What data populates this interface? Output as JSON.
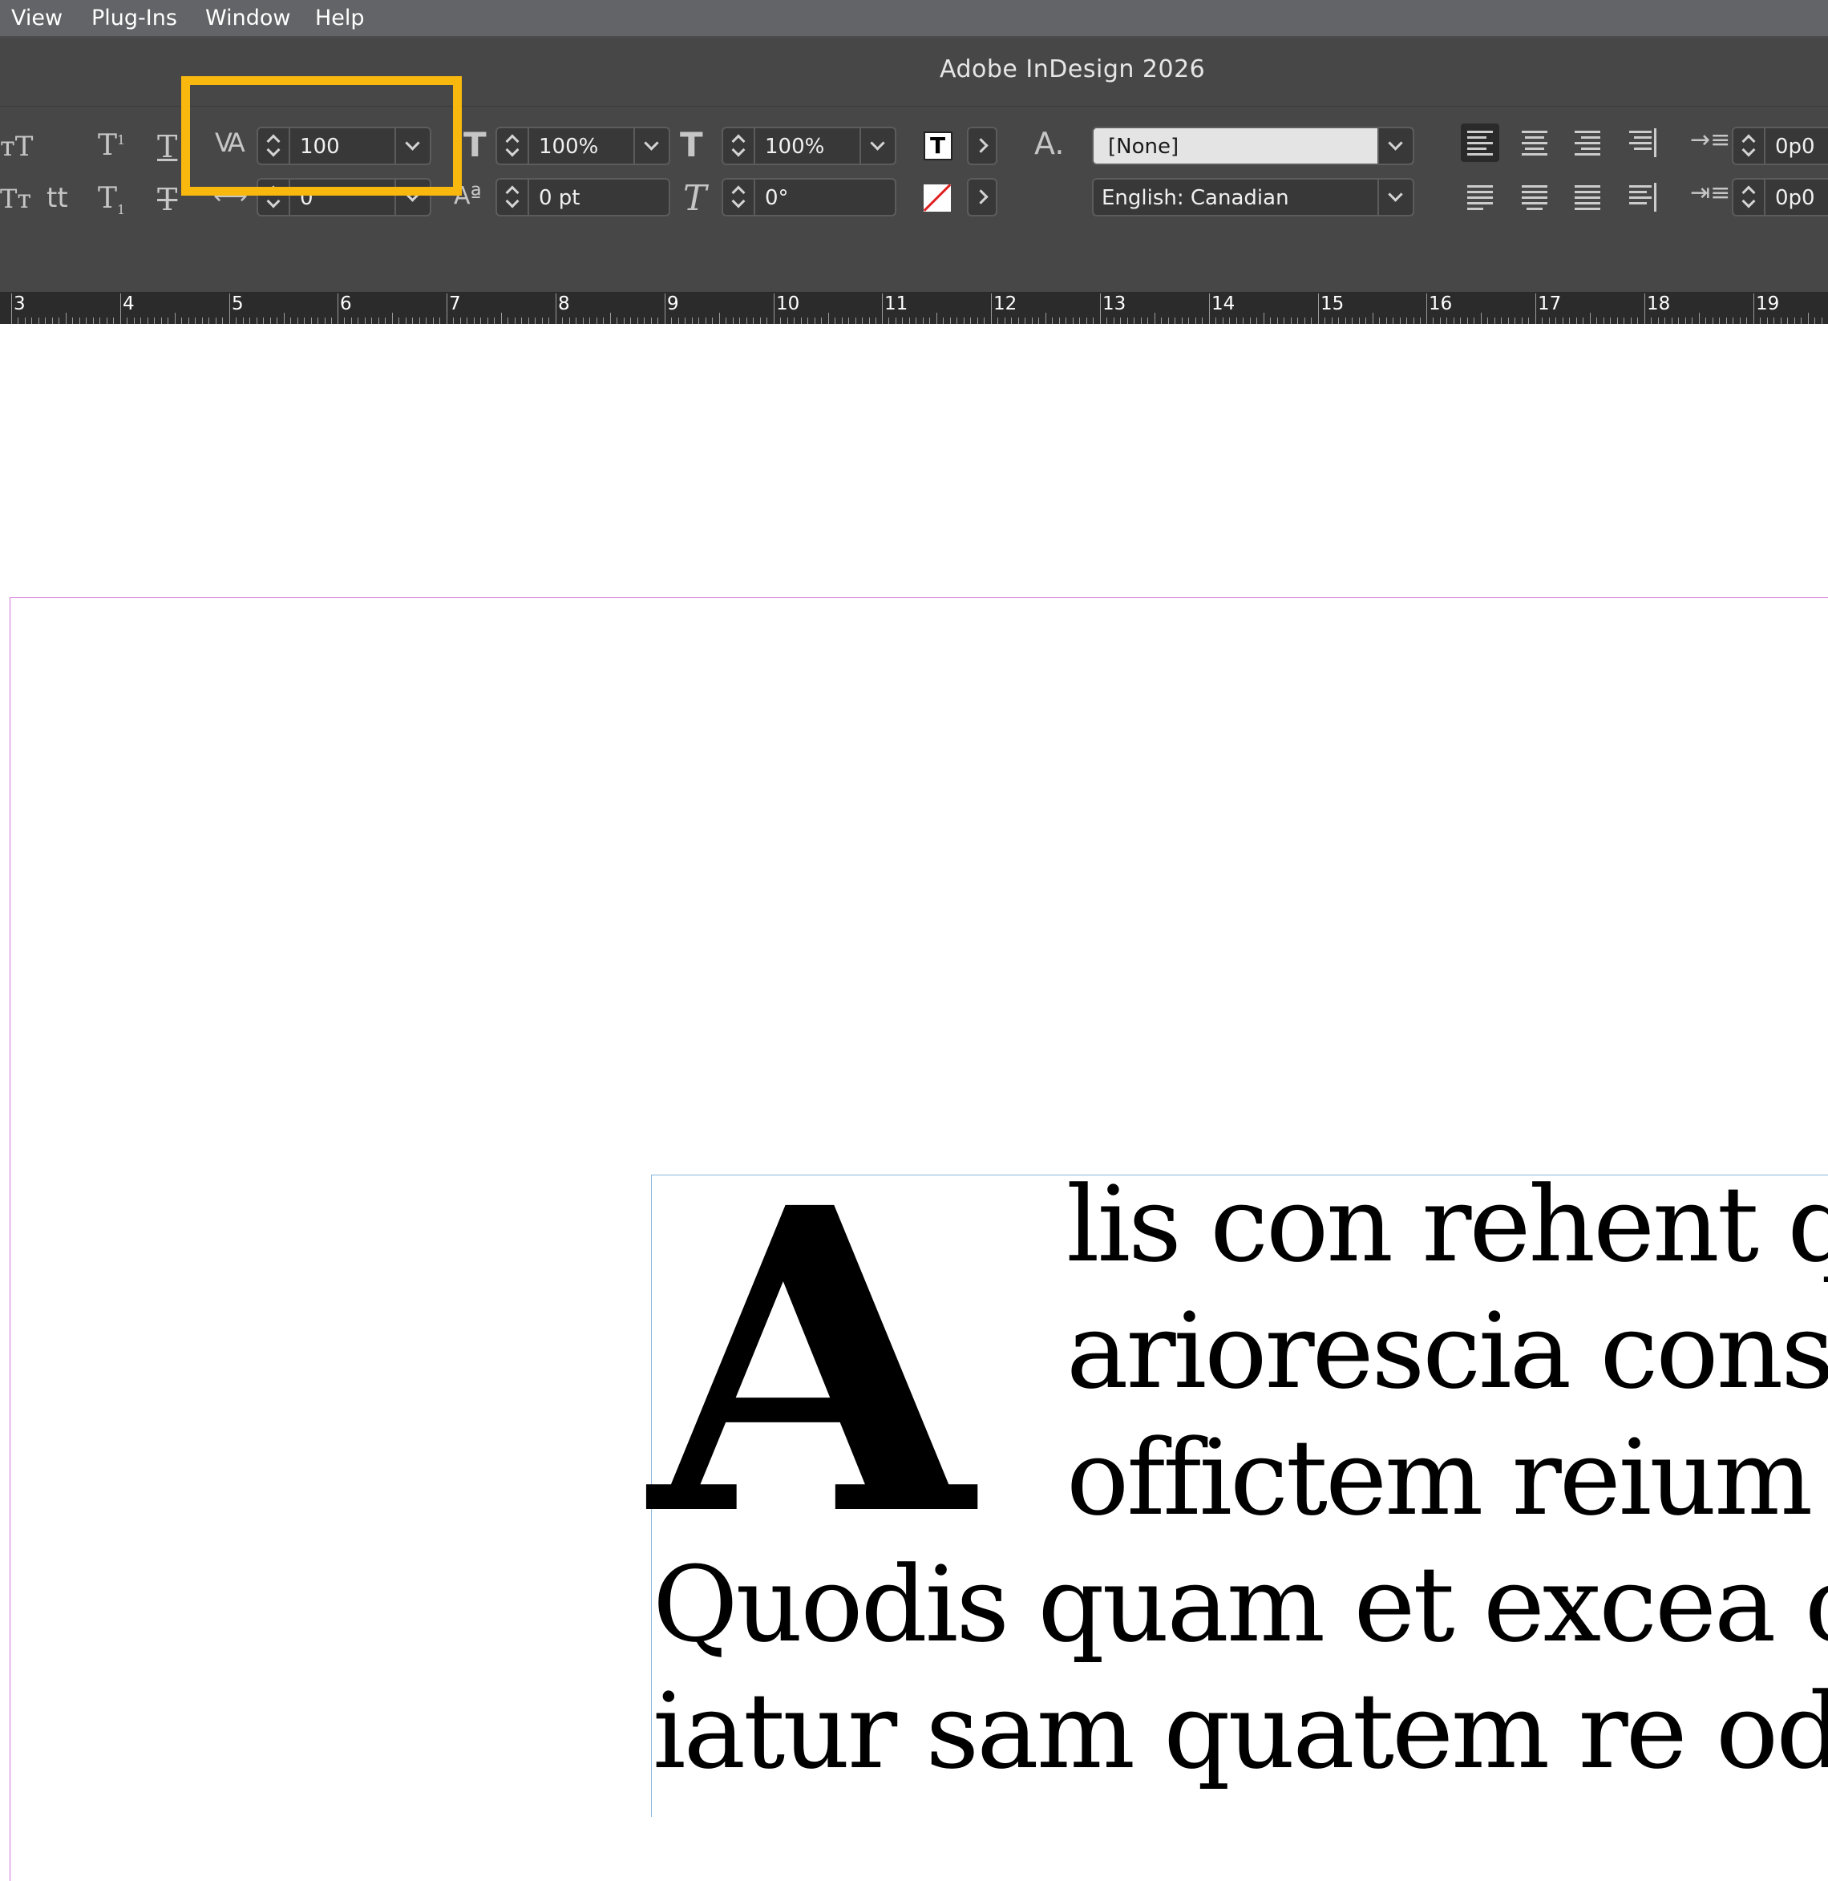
{
  "menubar": {
    "items": [
      "View",
      "Plug-Ins",
      "Window",
      "Help"
    ]
  },
  "titlebar": {
    "title": "Adobe InDesign 2026"
  },
  "control_panel": {
    "tracking_value": "100",
    "kerning_value": "0",
    "vertical_scale": "100%",
    "baseline_shift": "0 pt",
    "horizontal_scale": "100%",
    "skew": "0°",
    "character_style": "[None]",
    "language": "English: Canadian",
    "left_indent": "0p0",
    "first_line_indent": "0p0"
  },
  "ruler": {
    "labels": [
      "3",
      "4",
      "5",
      "6",
      "7",
      "8",
      "9",
      "10",
      "11",
      "12",
      "13",
      "14",
      "15",
      "16",
      "17",
      "18",
      "19"
    ]
  },
  "document": {
    "drop_cap": "A",
    "lines": [
      "lis con rehent q",
      "ariorescia cons",
      "offictem reium",
      "Quodis quam et excea c",
      "iatur sam quatem re od"
    ]
  },
  "colors": {
    "highlight": "#f8b80e",
    "margin_guide": "#d276d6",
    "frame_edge": "#8bb7e0"
  }
}
